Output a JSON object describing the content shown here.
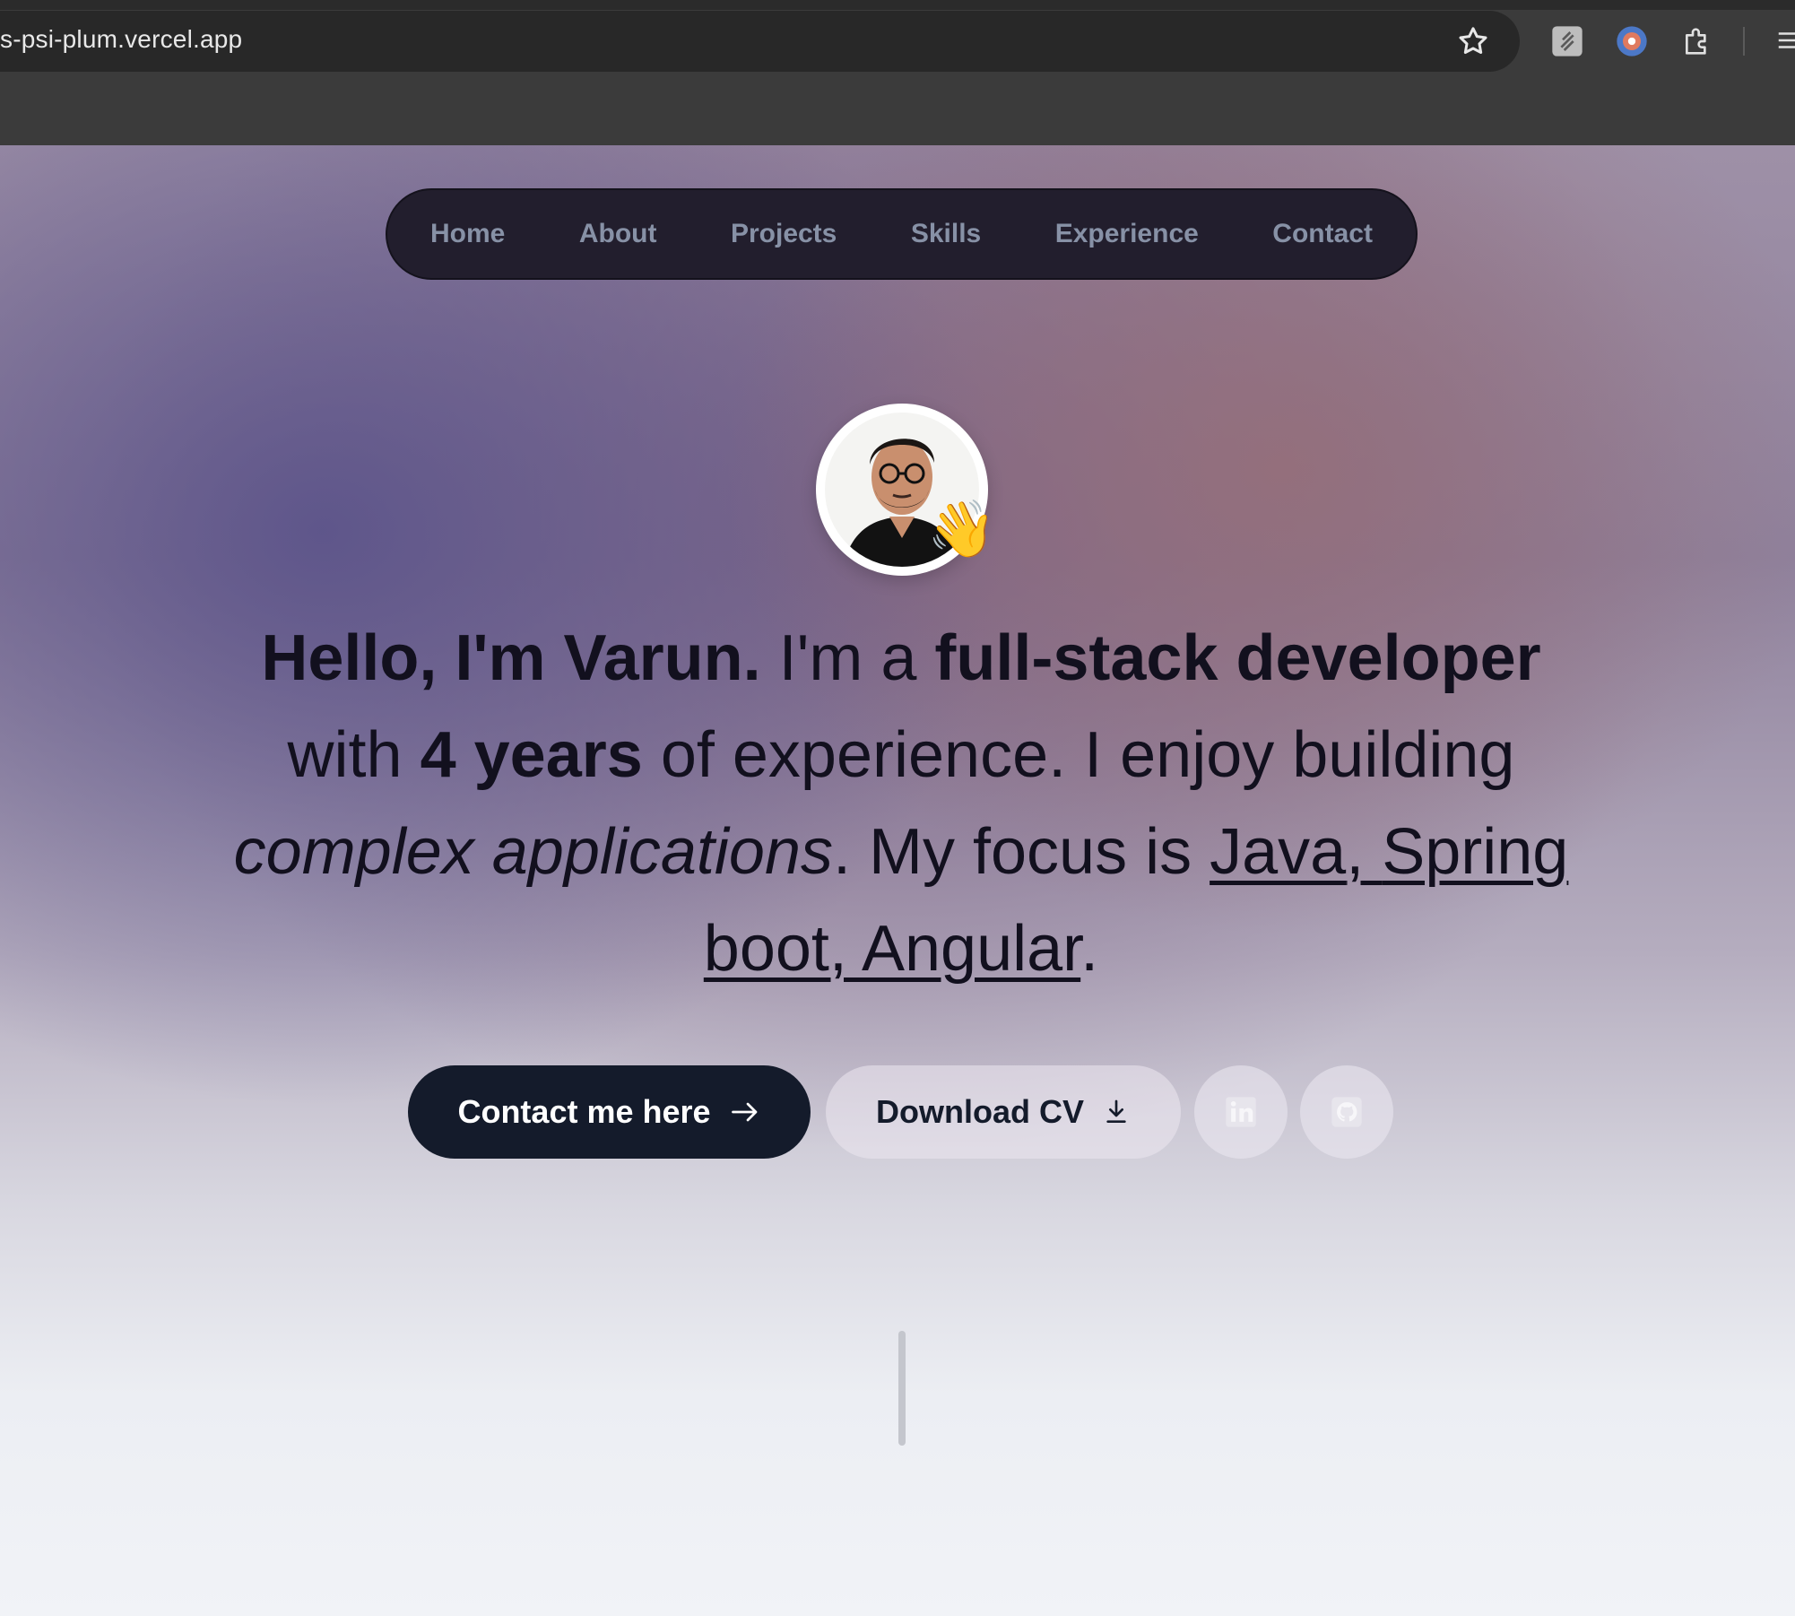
{
  "browser": {
    "url": "s-psi-plum.vercel.app",
    "icons": [
      "star-icon",
      "extension-note-icon",
      "extension-color-icon",
      "puzzle-icon",
      "menu-icon"
    ]
  },
  "nav": {
    "items": [
      {
        "label": "Home"
      },
      {
        "label": "About"
      },
      {
        "label": "Projects"
      },
      {
        "label": "Skills"
      },
      {
        "label": "Experience"
      },
      {
        "label": "Contact"
      }
    ]
  },
  "hero": {
    "greeting": "Hello, I'm Varun.",
    "t1": " I'm a ",
    "role": "full-stack developer",
    "t2": " with ",
    "years": "4 years",
    "t3": " of experience. I enjoy building ",
    "focus_italic": "complex applications",
    "t4": ". My focus is ",
    "tech1": "Java",
    "t5": ", ",
    "tech2": "Spring boot, Angular",
    "t6": ".",
    "wave_emoji": "👋"
  },
  "buttons": {
    "contact_label": "Contact me here",
    "contact_icon": "arrow-right-icon",
    "cv_label": "Download CV",
    "cv_icon": "download-icon",
    "linkedin_icon": "linkedin-icon",
    "github_icon": "github-icon"
  },
  "colors": {
    "nav_bg": "#221e2d",
    "nav_text": "#8791a6",
    "primary_button": "#141b2b",
    "heading_text": "#12101e"
  }
}
